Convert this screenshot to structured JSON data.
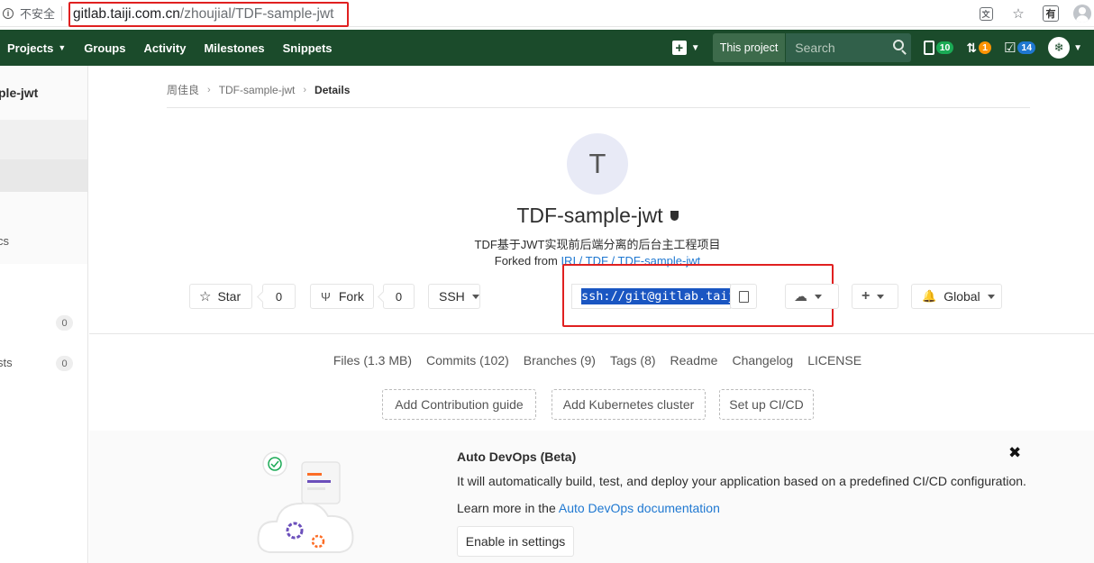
{
  "browser": {
    "insecure_label": "不安全",
    "url_host": "gitlab.taiji.com.cn",
    "url_path": "/zhoujial/TDF-sample-jwt",
    "reading_icon_char": "有"
  },
  "navbar": {
    "projects": "Projects",
    "groups": "Groups",
    "activity": "Activity",
    "milestones": "Milestones",
    "snippets": "Snippets",
    "search_scope": "This project",
    "search_placeholder": "Search",
    "issues_count": "10",
    "mr_count": "1",
    "todos_count": "14",
    "colors": {
      "issues_badge": "#1aaa55",
      "mr_badge": "#fc9403",
      "todos_badge": "#1f78d1"
    }
  },
  "sidebar": {
    "project_name_partial": "ple-jwt",
    "item_partial_1": "cs",
    "item_partial_2": "sts",
    "count_1": "0",
    "count_2": "0"
  },
  "breadcrumb": {
    "owner": "周佳良",
    "project": "TDF-sample-jwt",
    "current": "Details"
  },
  "project": {
    "avatar_letter": "T",
    "title": "TDF-sample-jwt",
    "description": "TDF基于JWT实现前后端分离的后台主工程项目",
    "forked_prefix": "Forked from ",
    "forked_link": "IRI / TDF / TDF-sample-jwt"
  },
  "actions": {
    "star_label": "Star",
    "star_count": "0",
    "fork_label": "Fork",
    "fork_count": "0",
    "protocol": "SSH",
    "clone_url": "ssh://git@gitlab.taiji.com.cn:",
    "notification": "Global"
  },
  "stats": {
    "files": "Files (1.3 MB)",
    "commits": "Commits (102)",
    "branches": "Branches (9)",
    "tags": "Tags (8)",
    "readme": "Readme",
    "changelog": "Changelog",
    "license": "LICENSE"
  },
  "setup_buttons": {
    "contribution": "Add Contribution guide",
    "kubernetes": "Add Kubernetes cluster",
    "cicd": "Set up CI/CD"
  },
  "devops": {
    "title": "Auto DevOps (Beta)",
    "text": "It will automatically build, test, and deploy your application based on a predefined CI/CD configuration.",
    "learn_prefix": "Learn more in the ",
    "learn_link": "Auto DevOps documentation",
    "enable_label": "Enable in settings",
    "close_char": "✖"
  }
}
